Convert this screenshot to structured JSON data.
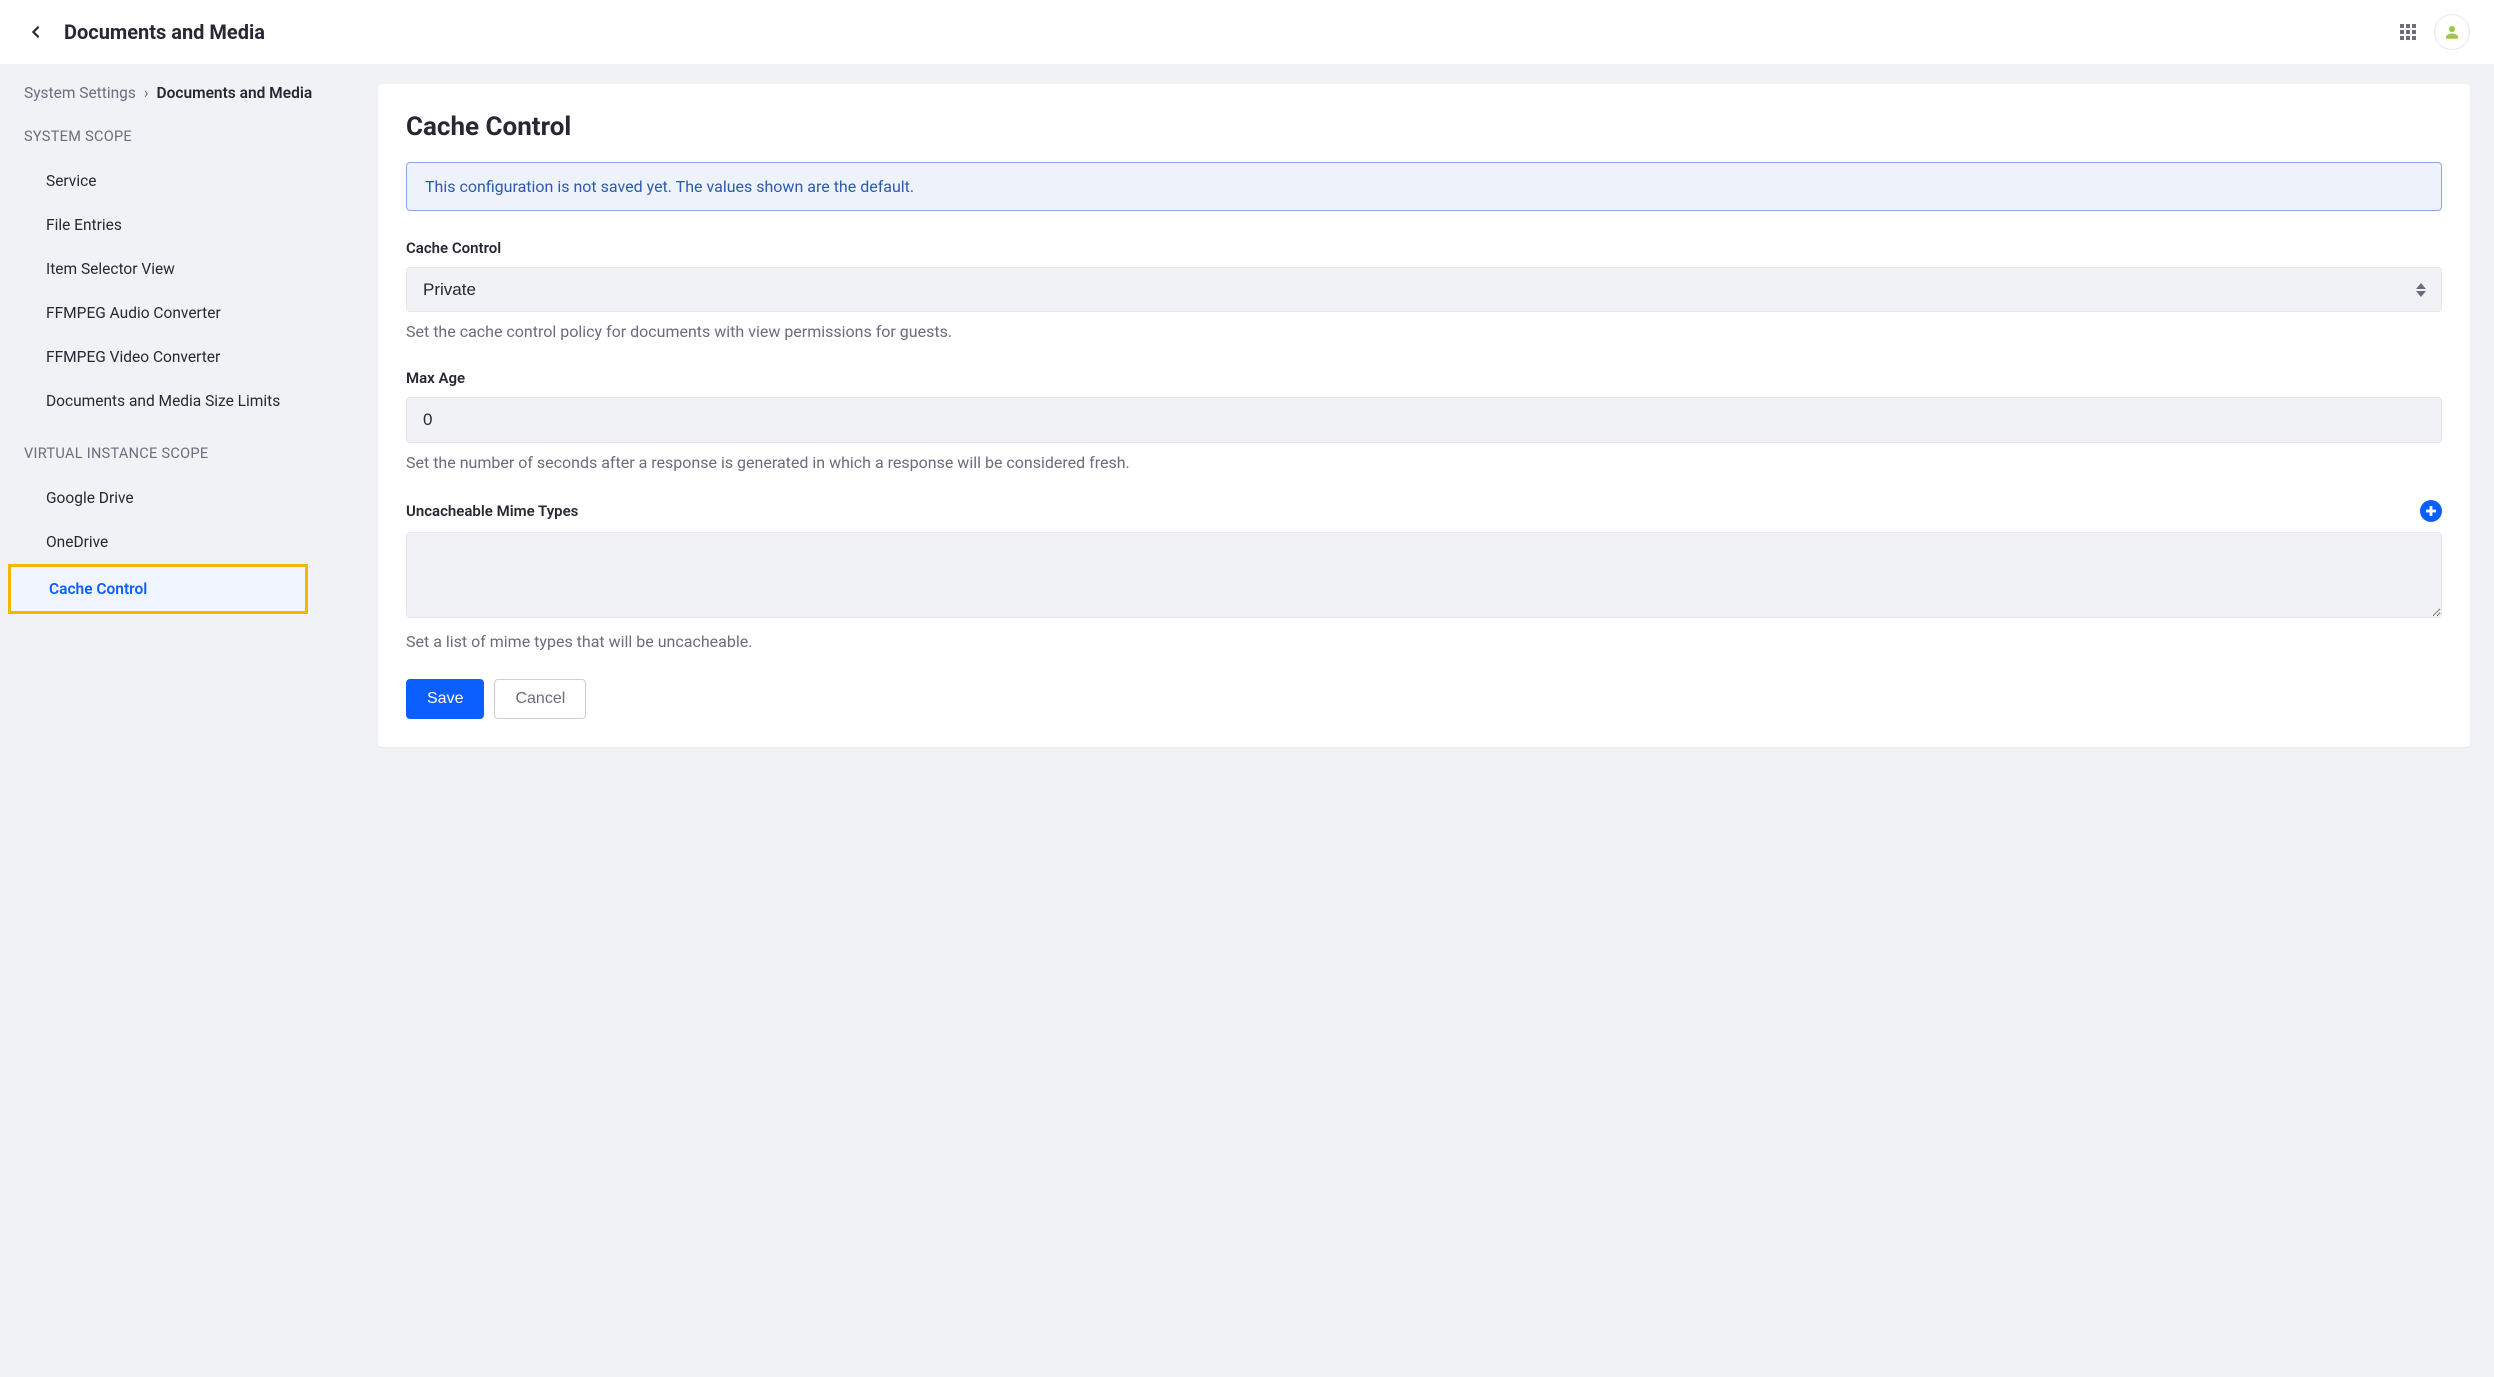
{
  "topbar": {
    "title": "Documents and Media"
  },
  "breadcrumb": {
    "parent": "System Settings",
    "current": "Documents and Media"
  },
  "sidebar": {
    "scope1_label": "SYSTEM SCOPE",
    "scope1_items": [
      "Service",
      "File Entries",
      "Item Selector View",
      "FFMPEG Audio Converter",
      "FFMPEG Video Converter",
      "Documents and Media Size Limits"
    ],
    "scope2_label": "VIRTUAL INSTANCE SCOPE",
    "scope2_items": [
      "Google Drive",
      "OneDrive",
      "Cache Control"
    ]
  },
  "page": {
    "title": "Cache Control",
    "alert": "This configuration is not saved yet. The values shown are the default."
  },
  "form": {
    "cache_control": {
      "label": "Cache Control",
      "value": "Private",
      "help": "Set the cache control policy for documents with view permissions for guests."
    },
    "max_age": {
      "label": "Max Age",
      "value": "0",
      "help": "Set the number of seconds after a response is generated in which a response will be considered fresh."
    },
    "mime_types": {
      "label": "Uncacheable Mime Types",
      "value": "",
      "help": "Set a list of mime types that will be uncacheable."
    }
  },
  "buttons": {
    "save": "Save",
    "cancel": "Cancel"
  }
}
